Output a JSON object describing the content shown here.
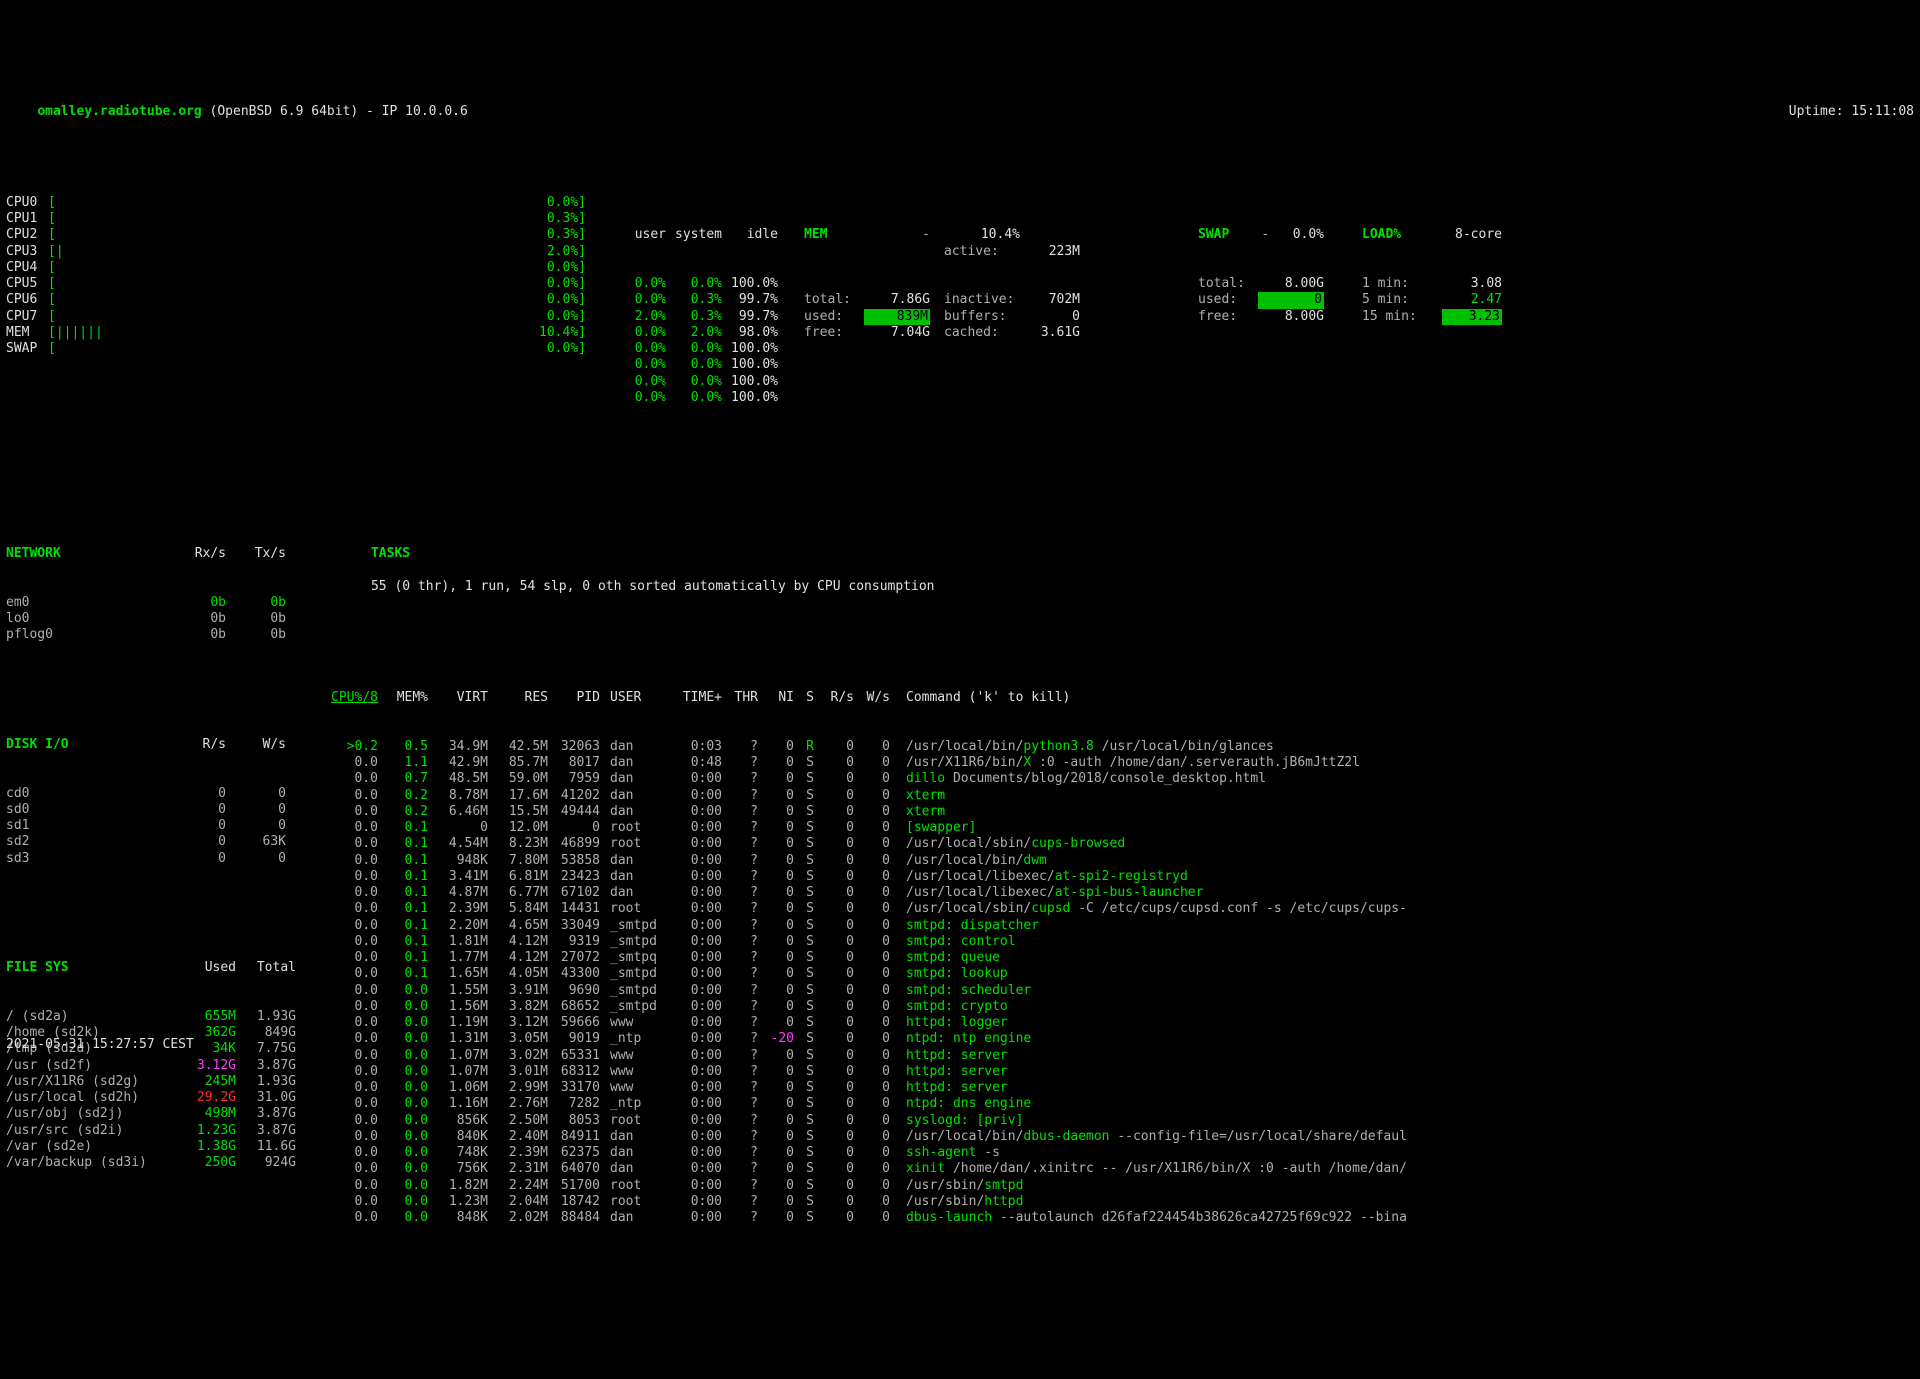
{
  "header": {
    "hostname": "omalley.radiotube.org",
    "os": " (OpenBSD 6.9 64bit) - IP 10.0.0.6",
    "uptime_label": "Uptime: ",
    "uptime": "15:11:08"
  },
  "cpu_bars": [
    {
      "label": "CPU0",
      "bar": "[",
      "pct": "0.0%]"
    },
    {
      "label": "CPU1",
      "bar": "[",
      "pct": "0.3%]"
    },
    {
      "label": "CPU2",
      "bar": "[",
      "pct": "0.3%]"
    },
    {
      "label": "CPU3",
      "bar": "[|",
      "pct": "2.0%]"
    },
    {
      "label": "CPU4",
      "bar": "[",
      "pct": "0.0%]"
    },
    {
      "label": "CPU5",
      "bar": "[",
      "pct": "0.0%]"
    },
    {
      "label": "CPU6",
      "bar": "[",
      "pct": "0.0%]"
    },
    {
      "label": "CPU7",
      "bar": "[",
      "pct": "0.0%]"
    },
    {
      "label": "MEM",
      "bar": "[||||||",
      "pct": "10.4%]"
    },
    {
      "label": "SWAP",
      "bar": "[",
      "pct": "0.0%]"
    }
  ],
  "usi": {
    "headers": [
      "user",
      "system",
      "idle"
    ],
    "rows": [
      [
        "0.0%",
        "0.0%",
        "100.0%"
      ],
      [
        "0.0%",
        "0.3%",
        " 99.7%"
      ],
      [
        "2.0%",
        "0.3%",
        " 99.7%"
      ],
      [
        "0.0%",
        "2.0%",
        " 98.0%"
      ],
      [
        "0.0%",
        "0.0%",
        "100.0%"
      ],
      [
        "0.0%",
        "0.0%",
        "100.0%"
      ],
      [
        "0.0%",
        "0.0%",
        "100.0%"
      ],
      [
        "0.0%",
        "0.0%",
        "100.0%"
      ]
    ]
  },
  "mem": {
    "title": "MEM",
    "dash": "-",
    "pct": "10.4%",
    "rows": [
      {
        "k": "total:",
        "v": "7.86G",
        "k2": "inactive:",
        "v2": "702M"
      },
      {
        "k": "used:",
        "v": "839M",
        "k2": "buffers:",
        "v2": "0",
        "v_hl": true
      },
      {
        "k": "free:",
        "v": "7.04G",
        "k2": "cached:",
        "v2": "3.61G"
      }
    ],
    "active_k": "active:",
    "active_v": "223M"
  },
  "swap": {
    "title": "SWAP",
    "dash": "-",
    "pct": "0.0%",
    "rows": [
      {
        "k": "total:",
        "v": "8.00G"
      },
      {
        "k": "used:",
        "v": "0",
        "v_hl": true
      },
      {
        "k": "free:",
        "v": "8.00G"
      }
    ]
  },
  "load": {
    "title": "LOAD%",
    "core": "8-core",
    "rows": [
      {
        "k": "1 min:",
        "v": "3.08",
        "cls": ""
      },
      {
        "k": "5 min:",
        "v": "2.47",
        "cls": "green"
      },
      {
        "k": "15 min:",
        "v": "3.23",
        "cls": "hl-green-bg"
      }
    ]
  },
  "network": {
    "title": "NETWORK",
    "h1": "Rx/s",
    "h2": "Tx/s",
    "rows": [
      {
        "n": "em0",
        "rx": "0b",
        "tx": "0b",
        "cls": "green"
      },
      {
        "n": "lo0",
        "rx": "0b",
        "tx": "0b"
      },
      {
        "n": "pflog0",
        "rx": "0b",
        "tx": "0b"
      }
    ]
  },
  "disk": {
    "title": "DISK I/O",
    "h1": "R/s",
    "h2": "W/s",
    "rows": [
      {
        "n": "cd0",
        "r": "0",
        "w": "0"
      },
      {
        "n": "sd0",
        "r": "0",
        "w": "0"
      },
      {
        "n": "sd1",
        "r": "0",
        "w": "0"
      },
      {
        "n": "sd2",
        "r": "0",
        "w": "63K"
      },
      {
        "n": "sd3",
        "r": "0",
        "w": "0"
      }
    ]
  },
  "fs": {
    "title": "FILE SYS",
    "h1": "Used",
    "h2": "Total",
    "rows": [
      {
        "n": "/ (sd2a)",
        "u": "655M",
        "t": "1.93G",
        "cls": "green"
      },
      {
        "n": "/home (sd2k)",
        "u": "362G",
        "t": "849G",
        "cls": "green"
      },
      {
        "n": "/tmp (sd2d)",
        "u": "34K",
        "t": "7.75G",
        "cls": "green"
      },
      {
        "n": "/usr (sd2f)",
        "u": "3.12G",
        "t": "3.87G",
        "cls": "magenta"
      },
      {
        "n": "/usr/X11R6 (sd2g)",
        "u": "245M",
        "t": "1.93G",
        "cls": "green"
      },
      {
        "n": "/usr/local (sd2h)",
        "u": "29.2G",
        "t": "31.0G",
        "cls": "red"
      },
      {
        "n": "/usr/obj (sd2j)",
        "u": "498M",
        "t": "3.87G",
        "cls": "green"
      },
      {
        "n": "/usr/src (sd2i)",
        "u": "1.23G",
        "t": "3.87G",
        "cls": "green"
      },
      {
        "n": "/var (sd2e)",
        "u": "1.38G",
        "t": "11.6G",
        "cls": "green"
      },
      {
        "n": "/var/backup (sd3i)",
        "u": "250G",
        "t": "924G",
        "cls": "green"
      }
    ]
  },
  "tasks": {
    "title": "TASKS",
    "summary": "55 (0 thr), 1 run, 54 slp, 0 oth sorted automatically by CPU consumption",
    "headers": [
      "CPU%/8",
      "MEM%",
      "VIRT",
      "RES",
      "PID",
      "USER",
      "TIME+",
      "THR",
      "NI",
      "S",
      "R/s",
      "W/s",
      "Command ('k' to kill)"
    ],
    "rows": [
      {
        "cpu": ">0.2",
        "mem": "0.5",
        "virt": "34.9M",
        "res": "42.5M",
        "pid": "32063",
        "user": "dan",
        "time": "0:03",
        "thr": "?",
        "ni": "0",
        "s": "R",
        "rs": "0",
        "ws": "0",
        "cmd_pre": "/usr/local/bin/",
        "cmd_hi": "python3.8",
        "cmd_post": " /usr/local/bin/glances",
        "s_cls": "green",
        "cpu_cls": "green"
      },
      {
        "cpu": "0.0",
        "mem": "1.1",
        "virt": "42.9M",
        "res": "85.7M",
        "pid": "8017",
        "user": "dan",
        "time": "0:48",
        "thr": "?",
        "ni": "0",
        "s": "S",
        "rs": "0",
        "ws": "0",
        "cmd_pre": "/usr/X11R6/bin/",
        "cmd_hi": "X",
        "cmd_post": " :0 -auth /home/dan/.serverauth.jB6mJttZ2l",
        "mem_cls": "green"
      },
      {
        "cpu": "0.0",
        "mem": "0.7",
        "virt": "48.5M",
        "res": "59.0M",
        "pid": "7959",
        "user": "dan",
        "time": "0:00",
        "thr": "?",
        "ni": "0",
        "s": "S",
        "rs": "0",
        "ws": "0",
        "cmd_pre": "",
        "cmd_hi": "dillo",
        "cmd_post": " Documents/blog/2018/console_desktop.html",
        "mem_cls": "green"
      },
      {
        "cpu": "0.0",
        "mem": "0.2",
        "virt": "8.78M",
        "res": "17.6M",
        "pid": "41202",
        "user": "dan",
        "time": "0:00",
        "thr": "?",
        "ni": "0",
        "s": "S",
        "rs": "0",
        "ws": "0",
        "cmd_pre": "",
        "cmd_hi": "xterm",
        "cmd_post": "",
        "mem_cls": "green"
      },
      {
        "cpu": "0.0",
        "mem": "0.2",
        "virt": "6.46M",
        "res": "15.5M",
        "pid": "49444",
        "user": "dan",
        "time": "0:00",
        "thr": "?",
        "ni": "0",
        "s": "S",
        "rs": "0",
        "ws": "0",
        "cmd_pre": "",
        "cmd_hi": "xterm",
        "cmd_post": "",
        "mem_cls": "green"
      },
      {
        "cpu": "0.0",
        "mem": "0.1",
        "virt": "0",
        "res": "12.0M",
        "pid": "0",
        "user": "root",
        "time": "0:00",
        "thr": "?",
        "ni": "0",
        "s": "S",
        "rs": "0",
        "ws": "0",
        "cmd_pre": "",
        "cmd_hi": "[swapper]",
        "cmd_post": "",
        "mem_cls": "green"
      },
      {
        "cpu": "0.0",
        "mem": "0.1",
        "virt": "4.54M",
        "res": "8.23M",
        "pid": "46899",
        "user": "root",
        "time": "0:00",
        "thr": "?",
        "ni": "0",
        "s": "S",
        "rs": "0",
        "ws": "0",
        "cmd_pre": "/usr/local/sbin/",
        "cmd_hi": "cups-browsed",
        "cmd_post": "",
        "mem_cls": "green"
      },
      {
        "cpu": "0.0",
        "mem": "0.1",
        "virt": "948K",
        "res": "7.80M",
        "pid": "53858",
        "user": "dan",
        "time": "0:00",
        "thr": "?",
        "ni": "0",
        "s": "S",
        "rs": "0",
        "ws": "0",
        "cmd_pre": "/usr/local/bin/",
        "cmd_hi": "dwm",
        "cmd_post": "",
        "mem_cls": "green"
      },
      {
        "cpu": "0.0",
        "mem": "0.1",
        "virt": "3.41M",
        "res": "6.81M",
        "pid": "23423",
        "user": "dan",
        "time": "0:00",
        "thr": "?",
        "ni": "0",
        "s": "S",
        "rs": "0",
        "ws": "0",
        "cmd_pre": "/usr/local/libexec/",
        "cmd_hi": "at-spi2-registryd",
        "cmd_post": "",
        "mem_cls": "green"
      },
      {
        "cpu": "0.0",
        "mem": "0.1",
        "virt": "4.87M",
        "res": "6.77M",
        "pid": "67102",
        "user": "dan",
        "time": "0:00",
        "thr": "?",
        "ni": "0",
        "s": "S",
        "rs": "0",
        "ws": "0",
        "cmd_pre": "/usr/local/libexec/",
        "cmd_hi": "at-spi-bus-launcher",
        "cmd_post": "",
        "mem_cls": "green"
      },
      {
        "cpu": "0.0",
        "mem": "0.1",
        "virt": "2.39M",
        "res": "5.84M",
        "pid": "14431",
        "user": "root",
        "time": "0:00",
        "thr": "?",
        "ni": "0",
        "s": "S",
        "rs": "0",
        "ws": "0",
        "cmd_pre": "/usr/local/sbin/",
        "cmd_hi": "cupsd",
        "cmd_post": " -C /etc/cups/cupsd.conf -s /etc/cups/cups-",
        "mem_cls": "green"
      },
      {
        "cpu": "0.0",
        "mem": "0.1",
        "virt": "2.20M",
        "res": "4.65M",
        "pid": "33049",
        "user": "_smtpd",
        "time": "0:00",
        "thr": "?",
        "ni": "0",
        "s": "S",
        "rs": "0",
        "ws": "0",
        "cmd_pre": "",
        "cmd_hi": "smtpd: dispatcher",
        "cmd_post": "",
        "mem_cls": "green"
      },
      {
        "cpu": "0.0",
        "mem": "0.1",
        "virt": "1.81M",
        "res": "4.12M",
        "pid": "9319",
        "user": "_smtpd",
        "time": "0:00",
        "thr": "?",
        "ni": "0",
        "s": "S",
        "rs": "0",
        "ws": "0",
        "cmd_pre": "",
        "cmd_hi": "smtpd: control",
        "cmd_post": "",
        "mem_cls": "green"
      },
      {
        "cpu": "0.0",
        "mem": "0.1",
        "virt": "1.77M",
        "res": "4.12M",
        "pid": "27072",
        "user": "_smtpq",
        "time": "0:00",
        "thr": "?",
        "ni": "0",
        "s": "S",
        "rs": "0",
        "ws": "0",
        "cmd_pre": "",
        "cmd_hi": "smtpd: queue",
        "cmd_post": "",
        "mem_cls": "green"
      },
      {
        "cpu": "0.0",
        "mem": "0.1",
        "virt": "1.65M",
        "res": "4.05M",
        "pid": "43300",
        "user": "_smtpd",
        "time": "0:00",
        "thr": "?",
        "ni": "0",
        "s": "S",
        "rs": "0",
        "ws": "0",
        "cmd_pre": "",
        "cmd_hi": "smtpd: lookup",
        "cmd_post": "",
        "mem_cls": "green"
      },
      {
        "cpu": "0.0",
        "mem": "0.0",
        "virt": "1.55M",
        "res": "3.91M",
        "pid": "9690",
        "user": "_smtpd",
        "time": "0:00",
        "thr": "?",
        "ni": "0",
        "s": "S",
        "rs": "0",
        "ws": "0",
        "cmd_pre": "",
        "cmd_hi": "smtpd: scheduler",
        "cmd_post": "",
        "mem_cls": "green"
      },
      {
        "cpu": "0.0",
        "mem": "0.0",
        "virt": "1.56M",
        "res": "3.82M",
        "pid": "68652",
        "user": "_smtpd",
        "time": "0:00",
        "thr": "?",
        "ni": "0",
        "s": "S",
        "rs": "0",
        "ws": "0",
        "cmd_pre": "",
        "cmd_hi": "smtpd: crypto",
        "cmd_post": "",
        "mem_cls": "green"
      },
      {
        "cpu": "0.0",
        "mem": "0.0",
        "virt": "1.19M",
        "res": "3.12M",
        "pid": "59666",
        "user": "www",
        "time": "0:00",
        "thr": "?",
        "ni": "0",
        "s": "S",
        "rs": "0",
        "ws": "0",
        "cmd_pre": "",
        "cmd_hi": "httpd: logger",
        "cmd_post": "",
        "mem_cls": "green"
      },
      {
        "cpu": "0.0",
        "mem": "0.0",
        "virt": "1.31M",
        "res": "3.05M",
        "pid": "9019",
        "user": "_ntp",
        "time": "0:00",
        "thr": "?",
        "ni": "-20",
        "s": "S",
        "rs": "0",
        "ws": "0",
        "cmd_pre": "",
        "cmd_hi": "ntpd: ntp engine",
        "cmd_post": "",
        "mem_cls": "green",
        "ni_cls": "magenta"
      },
      {
        "cpu": "0.0",
        "mem": "0.0",
        "virt": "1.07M",
        "res": "3.02M",
        "pid": "65331",
        "user": "www",
        "time": "0:00",
        "thr": "?",
        "ni": "0",
        "s": "S",
        "rs": "0",
        "ws": "0",
        "cmd_pre": "",
        "cmd_hi": "httpd: server",
        "cmd_post": "",
        "mem_cls": "green"
      },
      {
        "cpu": "0.0",
        "mem": "0.0",
        "virt": "1.07M",
        "res": "3.01M",
        "pid": "68312",
        "user": "www",
        "time": "0:00",
        "thr": "?",
        "ni": "0",
        "s": "S",
        "rs": "0",
        "ws": "0",
        "cmd_pre": "",
        "cmd_hi": "httpd: server",
        "cmd_post": "",
        "mem_cls": "green"
      },
      {
        "cpu": "0.0",
        "mem": "0.0",
        "virt": "1.06M",
        "res": "2.99M",
        "pid": "33170",
        "user": "www",
        "time": "0:00",
        "thr": "?",
        "ni": "0",
        "s": "S",
        "rs": "0",
        "ws": "0",
        "cmd_pre": "",
        "cmd_hi": "httpd: server",
        "cmd_post": "",
        "mem_cls": "green"
      },
      {
        "cpu": "0.0",
        "mem": "0.0",
        "virt": "1.16M",
        "res": "2.76M",
        "pid": "7282",
        "user": "_ntp",
        "time": "0:00",
        "thr": "?",
        "ni": "0",
        "s": "S",
        "rs": "0",
        "ws": "0",
        "cmd_pre": "",
        "cmd_hi": "ntpd: dns engine",
        "cmd_post": "",
        "mem_cls": "green"
      },
      {
        "cpu": "0.0",
        "mem": "0.0",
        "virt": "856K",
        "res": "2.50M",
        "pid": "8053",
        "user": "root",
        "time": "0:00",
        "thr": "?",
        "ni": "0",
        "s": "S",
        "rs": "0",
        "ws": "0",
        "cmd_pre": "",
        "cmd_hi": "syslogd: [priv]",
        "cmd_post": "",
        "mem_cls": "green"
      },
      {
        "cpu": "0.0",
        "mem": "0.0",
        "virt": "840K",
        "res": "2.40M",
        "pid": "84911",
        "user": "dan",
        "time": "0:00",
        "thr": "?",
        "ni": "0",
        "s": "S",
        "rs": "0",
        "ws": "0",
        "cmd_pre": "/usr/local/bin/",
        "cmd_hi": "dbus-daemon",
        "cmd_post": " --config-file=/usr/local/share/defaul",
        "mem_cls": "green"
      },
      {
        "cpu": "0.0",
        "mem": "0.0",
        "virt": "748K",
        "res": "2.39M",
        "pid": "62375",
        "user": "dan",
        "time": "0:00",
        "thr": "?",
        "ni": "0",
        "s": "S",
        "rs": "0",
        "ws": "0",
        "cmd_pre": "",
        "cmd_hi": "ssh-agent",
        "cmd_post": " -s",
        "mem_cls": "green"
      },
      {
        "cpu": "0.0",
        "mem": "0.0",
        "virt": "756K",
        "res": "2.31M",
        "pid": "64070",
        "user": "dan",
        "time": "0:00",
        "thr": "?",
        "ni": "0",
        "s": "S",
        "rs": "0",
        "ws": "0",
        "cmd_pre": "",
        "cmd_hi": "xinit",
        "cmd_post": " /home/dan/.xinitrc -- /usr/X11R6/bin/X :0 -auth /home/dan/",
        "mem_cls": "green"
      },
      {
        "cpu": "0.0",
        "mem": "0.0",
        "virt": "1.82M",
        "res": "2.24M",
        "pid": "51700",
        "user": "root",
        "time": "0:00",
        "thr": "?",
        "ni": "0",
        "s": "S",
        "rs": "0",
        "ws": "0",
        "cmd_pre": "/usr/sbin/",
        "cmd_hi": "smtpd",
        "cmd_post": "",
        "mem_cls": "green"
      },
      {
        "cpu": "0.0",
        "mem": "0.0",
        "virt": "1.23M",
        "res": "2.04M",
        "pid": "18742",
        "user": "root",
        "time": "0:00",
        "thr": "?",
        "ni": "0",
        "s": "S",
        "rs": "0",
        "ws": "0",
        "cmd_pre": "/usr/sbin/",
        "cmd_hi": "httpd",
        "cmd_post": "",
        "mem_cls": "green"
      },
      {
        "cpu": "0.0",
        "mem": "0.0",
        "virt": "848K",
        "res": "2.02M",
        "pid": "88484",
        "user": "dan",
        "time": "0:00",
        "thr": "?",
        "ni": "0",
        "s": "S",
        "rs": "0",
        "ws": "0",
        "cmd_pre": "",
        "cmd_hi": "dbus-launch",
        "cmd_post": " --autolaunch d26faf224454b38626ca42725f69c922 --bina",
        "mem_cls": "green"
      }
    ]
  },
  "footer": "2021-05-31 15:27:57 CEST"
}
